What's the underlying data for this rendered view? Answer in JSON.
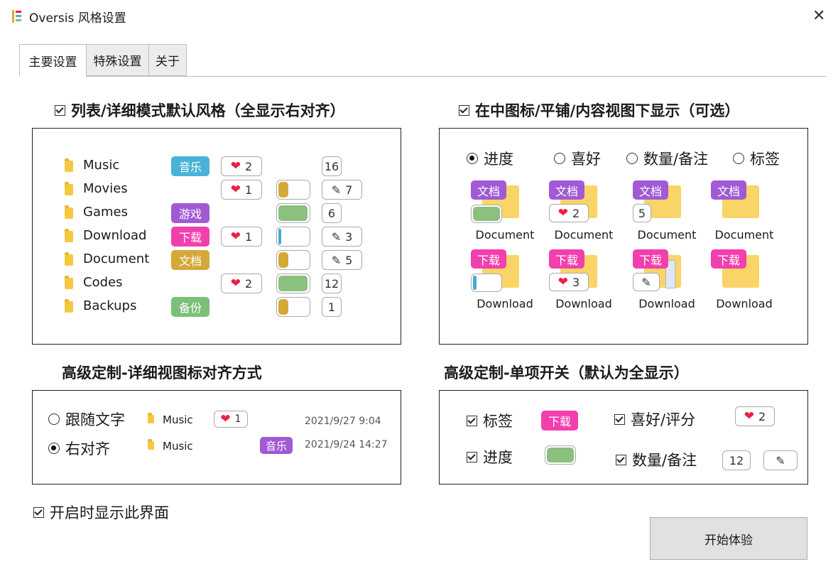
{
  "window": {
    "title": "Oversis 风格设置",
    "close_label": "✕"
  },
  "tabs": [
    {
      "label": "主要设置"
    },
    {
      "label": "特殊设置"
    },
    {
      "label": "关于"
    }
  ],
  "colors": {
    "music": "#48b3d6",
    "games": "#a15ad4",
    "download": "#f23fae",
    "document": "#d4a93a",
    "backups": "#7cbf78",
    "purple": "#a15ad4",
    "progress_gold": "#d4a93a",
    "progress_green": "#8bc07e",
    "progress_blue": "#4aa8e0"
  },
  "list_section": {
    "title": "列表/详细模式默认风格（全显示右对齐）",
    "rows": [
      {
        "name": "Music",
        "tag": "音乐",
        "tag_color": "#48b3d6",
        "rating": "2",
        "progress": null,
        "count": "16",
        "note": false
      },
      {
        "name": "Movies",
        "tag": "",
        "tag_color": "",
        "rating": "1",
        "progress": {
          "value": 0.35,
          "color": "#d4a93a"
        },
        "count": "7",
        "note": true
      },
      {
        "name": "Games",
        "tag": "游戏",
        "tag_color": "#a15ad4",
        "rating": "",
        "progress": {
          "value": 1.0,
          "color": "#8bc07e"
        },
        "count": "6",
        "note": false
      },
      {
        "name": "Download",
        "tag": "下载",
        "tag_color": "#f23fae",
        "rating": "1",
        "progress": {
          "value": 0.08,
          "color": "#4aa8e0"
        },
        "count": "3",
        "note": true
      },
      {
        "name": "Document",
        "tag": "文档",
        "tag_color": "#d4a93a",
        "rating": "",
        "progress": {
          "value": 0.35,
          "color": "#d4a93a"
        },
        "count": "5",
        "note": true
      },
      {
        "name": "Codes",
        "tag": "",
        "tag_color": "",
        "rating": "2",
        "progress": {
          "value": 1.0,
          "color": "#8bc07e"
        },
        "count": "12",
        "note": false
      },
      {
        "name": "Backups",
        "tag": "备份",
        "tag_color": "#7cbf78",
        "rating": "",
        "progress": {
          "value": 0.35,
          "color": "#d4a93a"
        },
        "count": "1",
        "note": false
      }
    ]
  },
  "icon_section": {
    "title": "在中图标/平铺/内容视图下显示（可选）",
    "options": [
      {
        "label": "进度",
        "selected": true
      },
      {
        "label": "喜好",
        "selected": false
      },
      {
        "label": "数量/备注",
        "selected": false
      },
      {
        "label": "标签",
        "selected": false
      }
    ],
    "row1": {
      "tag": "文档",
      "name": "Document",
      "rating": "2",
      "count": "5"
    },
    "row2": {
      "tag": "下载",
      "name": "Download",
      "rating": "3"
    }
  },
  "align_section": {
    "title": "高级定制-详细视图标对齐方式",
    "options": [
      {
        "label": "跟随文字",
        "selected": false,
        "file": "Music",
        "rating": "1",
        "date": "2021/9/27 9:04"
      },
      {
        "label": "右对齐",
        "selected": true,
        "file": "Music",
        "tag": "音乐",
        "date": "2021/9/24 14:27"
      }
    ]
  },
  "toggle_section": {
    "title": "高级定制-单项开关（默认为全显示）",
    "tag_label": "标签",
    "tag_sample": "下载",
    "fav_label": "喜好/评分",
    "fav_sample": "2",
    "progress_label": "进度",
    "count_label": "数量/备注",
    "count_sample": "12"
  },
  "footer": {
    "show_on_start": "开启时显示此界面",
    "start_button": "开始体验"
  }
}
